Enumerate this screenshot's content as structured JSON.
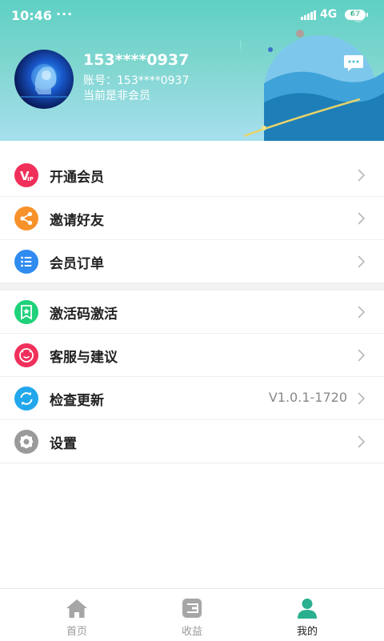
{
  "status_bar": {
    "time": "10:46",
    "dots": "···",
    "network": "4G",
    "battery": "67"
  },
  "profile": {
    "phone": "153****0937",
    "account": "账号：153****0937",
    "member_status": "当前是非会员"
  },
  "menu_group_1": [
    {
      "label": "开通会员",
      "icon": "vip-icon",
      "color": "#f0305a"
    },
    {
      "label": "邀请好友",
      "icon": "share-icon",
      "color": "#f7922a"
    },
    {
      "label": "会员订单",
      "icon": "list-icon",
      "color": "#2f8bf0"
    }
  ],
  "menu_group_2": [
    {
      "label": "激活码激活",
      "icon": "badge-icon",
      "color": "#1fd17a"
    },
    {
      "label": "客服与建议",
      "icon": "chat-face-icon",
      "color": "#f0305a"
    },
    {
      "label": "检查更新",
      "icon": "refresh-icon",
      "color": "#22a7ec",
      "value": "V1.0.1-1720"
    },
    {
      "label": "设置",
      "icon": "gear-icon",
      "color": "#9a9a9a"
    }
  ],
  "bottom_nav": {
    "tabs": [
      {
        "label": "首页",
        "icon": "home-icon"
      },
      {
        "label": "收益",
        "icon": "wallet-icon"
      },
      {
        "label": "我的",
        "icon": "person-icon",
        "active": true
      }
    ],
    "active_color": "#2ab08e",
    "inactive_color": "#9a9a9a"
  }
}
